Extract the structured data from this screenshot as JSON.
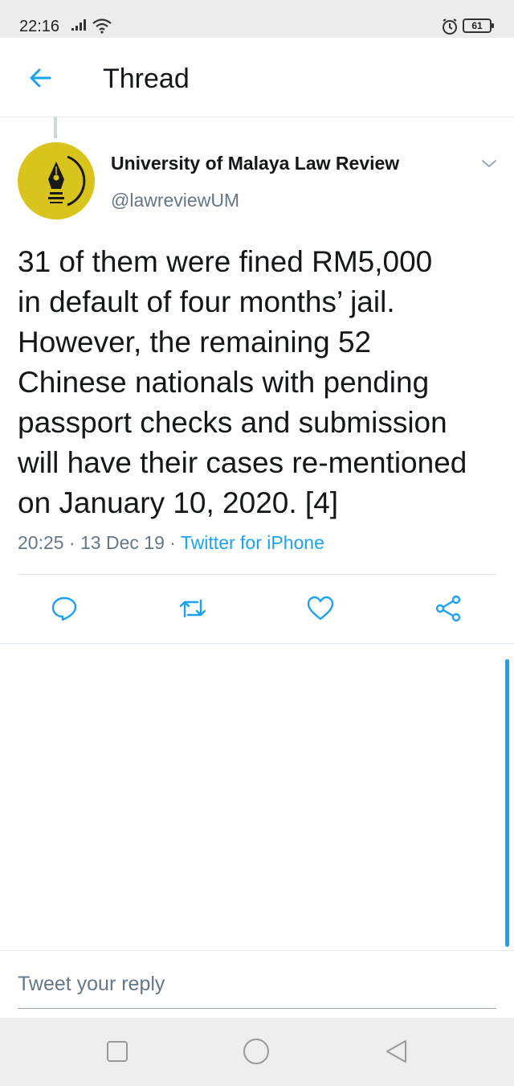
{
  "status_bar": {
    "time": "22:16",
    "battery": "61",
    "icons": [
      "signal-icon",
      "wifi-icon",
      "alarm-icon",
      "battery-icon"
    ]
  },
  "header": {
    "title": "Thread",
    "back_icon": "arrow-left-icon"
  },
  "tweet": {
    "author_name": "University of Malaya Law Review",
    "author_handle": "@lawreviewUM",
    "text": "31 of them were fined RM5,000\nin default of four months’ jail.\nHowever, the remaining 52\nChinese nationals with pending\npassport checks and submission\nwill have their cases re-mentioned\non January 10, 2020. [4]",
    "time": "20:25",
    "separator": "·",
    "date": "13 Dec 19",
    "source": "Twitter for iPhone"
  },
  "actions": [
    "reply-icon",
    "retweet-icon",
    "like-icon",
    "share-icon"
  ],
  "reply": {
    "placeholder": "Tweet your reply"
  },
  "nav": [
    "recents-button",
    "home-button",
    "back-button"
  ],
  "colors": {
    "accent": "#1da1f2",
    "secondary_text": "#657786",
    "avatar_bg": "#d9c41d",
    "divider": "#e1e8ed"
  }
}
